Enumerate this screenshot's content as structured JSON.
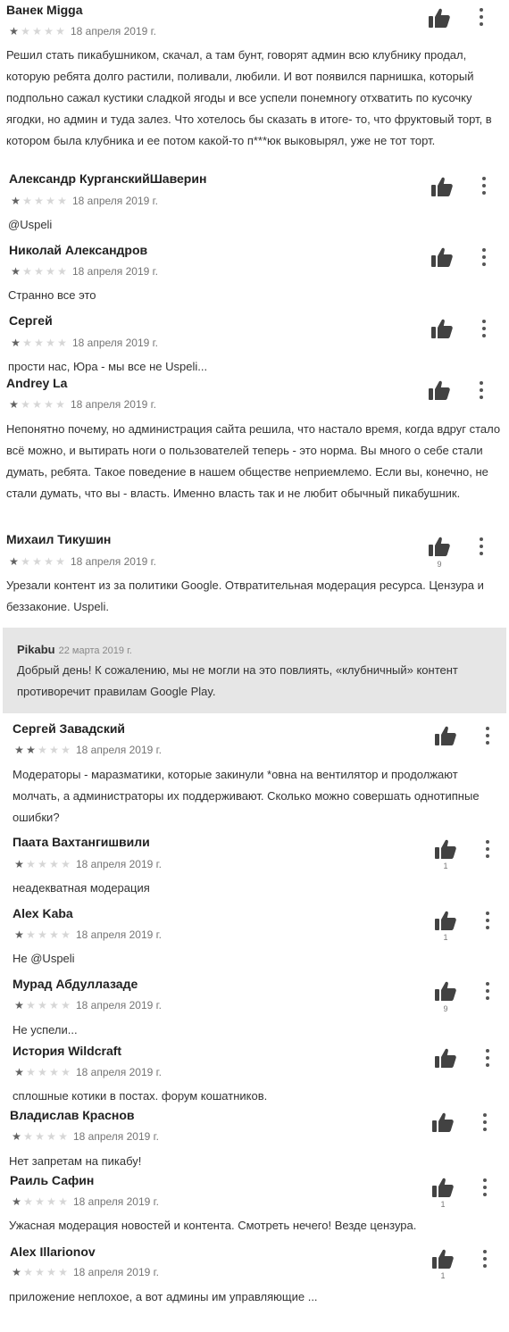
{
  "reviews": [
    {
      "name": "Ванек Migga",
      "stars": 1,
      "date": "18 апреля 2019 г.",
      "text": "Решил стать пикабушником, скачал, а там бунт, говорят админ всю клубнику продал, которую ребята долго растили, поливали, любили. И вот появился парнишка, который подпольно сажал кустики сладкой ягоды и все успели понемногу отхватить по кусочку ягодки, но админ и туда залез. Что хотелось бы сказать в итоге- то, что фруктовый торт, в котором была клубника и ее потом какой-то п***юк выковырял, уже не тот торт.",
      "likes": ""
    },
    {
      "name": "Александр КурганскийШаверин",
      "stars": 1,
      "date": "18 апреля 2019 г.",
      "text": "@Uspeli",
      "likes": ""
    },
    {
      "name": "Николай Александров",
      "stars": 1,
      "date": "18 апреля 2019 г.",
      "text": "Странно все это",
      "likes": ""
    },
    {
      "name": "Сергей",
      "stars": 1,
      "date": "18 апреля 2019 г.",
      "text": "прости нас, Юра - мы все не Uspeli...",
      "likes": ""
    },
    {
      "name": "Andrey La",
      "stars": 1,
      "date": "18 апреля 2019 г.",
      "text": "Непонятно почему, но администрация сайта решила, что настало время, когда вдруг стало всё можно, и вытирать ноги о пользователей теперь - это норма. Вы много о себе стали думать, ребята. Такое поведение в нашем обществе неприемлемо. Если вы, конечно, не стали думать, что вы - власть. Именно власть так и не любит обычный пикабушник.",
      "likes": ""
    },
    {
      "name": "Михаил Тикушин",
      "stars": 1,
      "date": "18 апреля 2019 г.",
      "text": "Урезали контент из за политики Google. Отвратительная модерация ресурса. Цензура и беззаконие. Uspeli.",
      "likes": "9"
    },
    {
      "name": "Сергей Завадский",
      "stars": 2,
      "date": "18 апреля 2019 г.",
      "text": "Модераторы - маразматики, которые закинули *овна на вентилятор и продолжают молчать, а администраторы их поддерживают. Сколько можно совершать однотипные ошибки?",
      "likes": ""
    },
    {
      "name": "Паата Вахтангишвили",
      "stars": 1,
      "date": "18 апреля 2019 г.",
      "text": "неадекватная модерация",
      "likes": "1"
    },
    {
      "name": "Alex Kaba",
      "stars": 1,
      "date": "18 апреля 2019 г.",
      "text": "Не @Uspeli",
      "likes": "1"
    },
    {
      "name": "Мурад Абдуллазаде",
      "stars": 1,
      "date": "18 апреля 2019 г.",
      "text": "Не успели...",
      "likes": "9"
    },
    {
      "name": "История Wildcraft",
      "stars": 1,
      "date": "18 апреля 2019 г.",
      "text": "сплошные котики в постах. форум кошатников.",
      "likes": ""
    },
    {
      "name": "Владислав Краснов",
      "stars": 1,
      "date": "18 апреля 2019 г.",
      "text": "Нет запретам на пикабу!",
      "likes": ""
    },
    {
      "name": "Раиль Сафин",
      "stars": 1,
      "date": "18 апреля 2019 г.",
      "text": "Ужасная модерация новостей и контента. Смотреть нечего! Везде цензура.",
      "likes": "1"
    },
    {
      "name": "Alex Illarionov",
      "stars": 1,
      "date": "18 апреля 2019 г.",
      "text": "приложение неплохое, а вот админы им управляющие ...",
      "likes": "1"
    }
  ],
  "developer_reply": {
    "name": "Pikabu",
    "date": "22 марта 2019 г.",
    "text": "Добрый день! К сожалению, мы не могли на это повлиять, «клубничный» контент противоречит правилам Google Play."
  },
  "colors": {
    "star_on": "#616161",
    "star_off": "#d6d6d6",
    "reply_bg": "#e6e6e6"
  },
  "icons": {
    "like": "thumb-up-icon",
    "menu": "more-vert-icon",
    "star": "star-icon"
  }
}
